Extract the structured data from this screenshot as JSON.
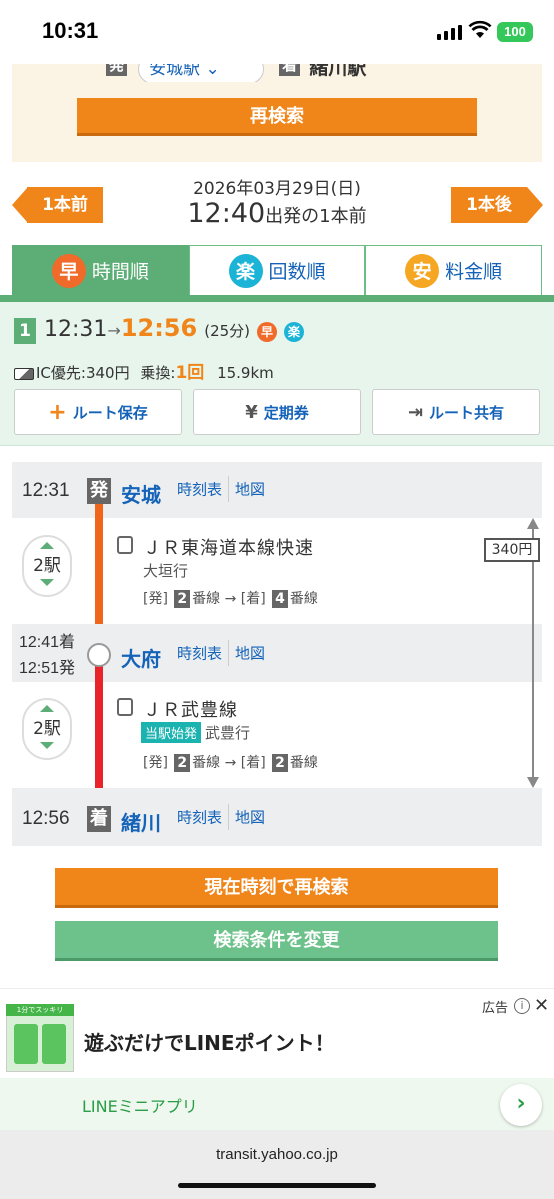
{
  "status_bar": {
    "time": "10:31",
    "battery": "100"
  },
  "search": {
    "dep_mark": "発",
    "dep_station": "安城駅",
    "arr_mark": "着",
    "arr_station": "緒川駅",
    "research_label": "再検索"
  },
  "nav": {
    "prev_label": "1本前",
    "next_label": "1本後",
    "date": "2026年03月29日(日)",
    "time": "12:40",
    "time_suffix": "出発の1本前"
  },
  "tabs": [
    {
      "icon_char": "早",
      "label": "時間順",
      "active": true,
      "icon_color": "#f06a2a"
    },
    {
      "icon_char": "楽",
      "label": "回数順",
      "active": false,
      "icon_color": "#1bb3d6"
    },
    {
      "icon_char": "安",
      "label": "料金順",
      "active": false,
      "icon_color": "#f5a623"
    }
  ],
  "route": {
    "number": "1",
    "dep_time": "12:31",
    "arrow": "→",
    "arr_time": "12:56",
    "duration": "(25分)",
    "badges": [
      "早",
      "楽"
    ],
    "fare_label": "IC優先:340円",
    "transfer_label": "乗換:",
    "transfer_count": "1回",
    "distance": "15.9km",
    "actions": [
      "ルート保存",
      "定期券",
      "ルート共有"
    ]
  },
  "timeline": {
    "stations": [
      {
        "time": "12:31",
        "mark": "発",
        "name": "安城",
        "links": [
          "時刻表",
          "地図"
        ]
      },
      {
        "time_arr": "12:41着",
        "time_dep": "12:51発",
        "name": "大府",
        "links": [
          "時刻表",
          "地図"
        ]
      },
      {
        "time": "12:56",
        "mark": "着",
        "name": "緒川",
        "links": [
          "時刻表",
          "地図"
        ]
      }
    ],
    "segments": [
      {
        "stops": "2駅",
        "train": "ＪＲ東海道本線快速",
        "dest": "大垣行",
        "tag": "",
        "platform_dep_label": "[発]",
        "platform_dep": "2",
        "platform_arr_label": "[着]",
        "platform_arr": "4",
        "platform_suffix": "番線"
      },
      {
        "stops": "2駅",
        "train": "ＪＲ武豊線",
        "dest": "武豊行",
        "tag": "当駅始発",
        "platform_dep_label": "[発]",
        "platform_dep": "2",
        "platform_arr_label": "[着]",
        "platform_arr": "2",
        "platform_suffix": "番線"
      }
    ],
    "fare": "340円"
  },
  "buttons": {
    "research_now": "現在時刻で再検索",
    "change_conditions": "検索条件を変更"
  },
  "ad": {
    "label": "広告",
    "headline": "遊ぶだけでLINEポイント！",
    "app_name": "LINEミニアプリ",
    "thumb_text": "1分でスッキリ"
  },
  "browser": {
    "url": "transit.yahoo.co.jp"
  }
}
